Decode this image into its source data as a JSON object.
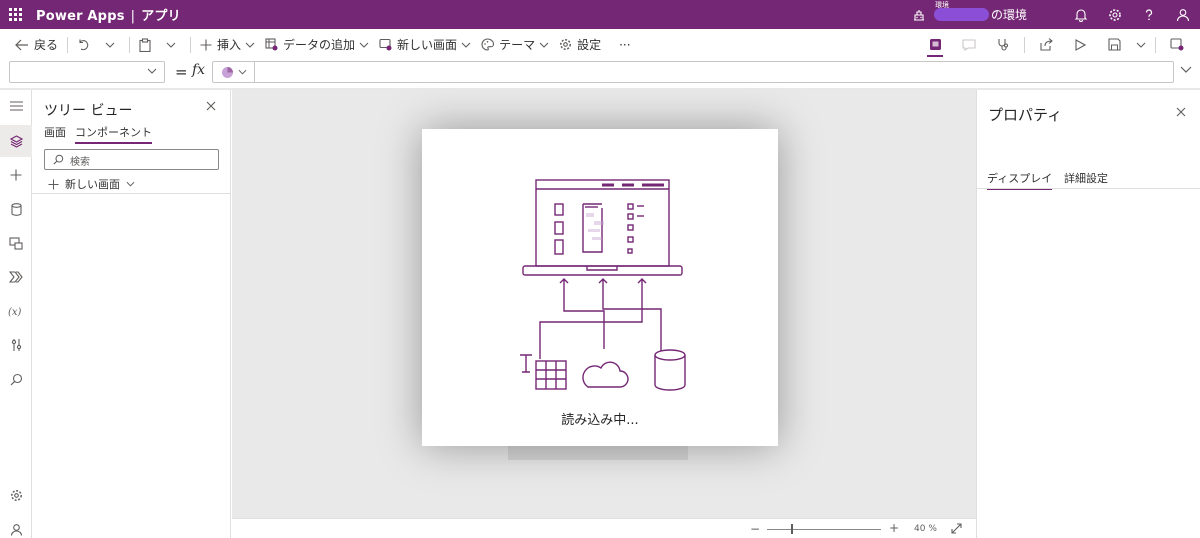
{
  "header": {
    "app_name": "Power Apps",
    "separator": "|",
    "app_section": "アプリ",
    "env_label_small": "環境",
    "env_suffix": "の環境"
  },
  "toolbar": {
    "back": "戻る",
    "insert": "挿入",
    "add_data": "データの追加",
    "new_screen": "新しい画面",
    "theme": "テーマ",
    "settings": "設定",
    "more": "···"
  },
  "formula": {
    "property_value": "",
    "equals": "=",
    "fx": "fx",
    "formula_value": ""
  },
  "tree_view": {
    "title": "ツリー ビュー",
    "tabs": [
      "画面",
      "コンポーネント"
    ],
    "active_tab": "コンポーネント",
    "search_placeholder": "検索",
    "new_screen": "新しい画面"
  },
  "dialog": {
    "loading_text": "読み込み中..."
  },
  "properties": {
    "title": "プロパティ",
    "tabs": [
      "ディスプレイ",
      "詳細設定"
    ],
    "active_tab": "ディスプレイ"
  },
  "zoom": {
    "minus": "−",
    "plus": "+",
    "value": "40 %",
    "level": 0.4
  },
  "colors": {
    "brand": "#742774",
    "env_blob": "#8a4fd6"
  }
}
